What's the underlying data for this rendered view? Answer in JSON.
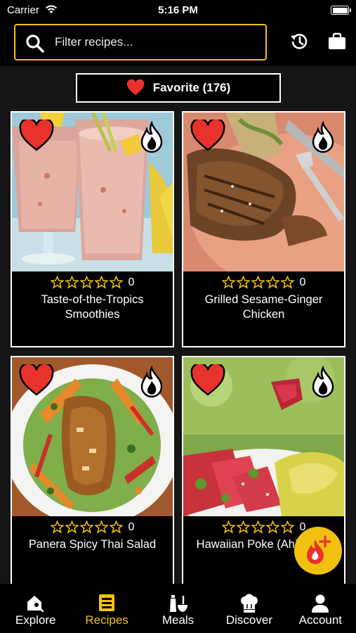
{
  "status_bar": {
    "carrier": "Carrier",
    "time": "5:16 PM"
  },
  "header": {
    "search_placeholder": "Filter recipes...",
    "icons": [
      "search-icon",
      "history-icon",
      "briefcase-icon"
    ]
  },
  "favorite_filter": {
    "label": "Favorite (176)",
    "icon": "heart-icon"
  },
  "recipes": [
    {
      "title": "Taste-of-the-Tropics Smoothies",
      "rating_count": "0",
      "stars": 0,
      "favorited": true
    },
    {
      "title": "Grilled Sesame-Ginger Chicken",
      "rating_count": "0",
      "stars": 0,
      "favorited": true
    },
    {
      "title": "Panera Spicy Thai Salad",
      "rating_count": "0",
      "stars": 0,
      "favorited": true
    },
    {
      "title": "Hawaiian Poke (Ahi Poke)",
      "rating_count": "0",
      "stars": 0,
      "favorited": true
    }
  ],
  "fab": {
    "icon": "add-flame-icon"
  },
  "tabs": [
    {
      "label": "Explore",
      "icon": "explore-icon",
      "active": false
    },
    {
      "label": "Recipes",
      "icon": "recipes-icon",
      "active": true
    },
    {
      "label": "Meals",
      "icon": "meals-icon",
      "active": false
    },
    {
      "label": "Discover",
      "icon": "chef-hat-icon",
      "active": false
    },
    {
      "label": "Account",
      "icon": "account-icon",
      "active": false
    }
  ],
  "colors": {
    "accent": "#f2c10f",
    "heart": "#e8332c",
    "background": "#151515"
  }
}
